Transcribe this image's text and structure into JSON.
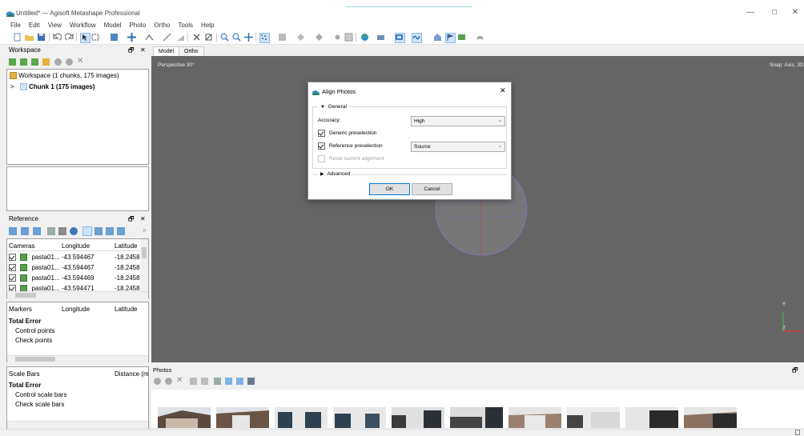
{
  "app": {
    "title": "Untitled* — Agisoft Metashape Professional",
    "window_controls": [
      "—",
      "☐",
      "✕"
    ]
  },
  "menu": [
    "File",
    "Edit",
    "View",
    "Workflow",
    "Model",
    "Photo",
    "Ortho",
    "Tools",
    "Help"
  ],
  "workspace": {
    "header": "Workspace",
    "root_label": "Workspace (1 chunks, 175 images)",
    "chunk_label": "Chunk 1 (175 images)"
  },
  "reference": {
    "header": "Reference",
    "cameras_cols": [
      "Cameras",
      "Longitude",
      "Latitude"
    ],
    "cameras": [
      {
        "name": "pasta01...",
        "lon": "-43.594467",
        "lat": "-18.2458"
      },
      {
        "name": "pasta01...",
        "lon": "-43.594467",
        "lat": "-18.2458"
      },
      {
        "name": "pasta01...",
        "lon": "-43.594469",
        "lat": "-18.2458"
      },
      {
        "name": "pasta01...",
        "lon": "-43.594471",
        "lat": "-18.2458"
      }
    ],
    "markers_cols": [
      "Markers",
      "Longitude",
      "Latitude"
    ],
    "markers_rows": [
      "Total Error",
      "Control points",
      "Check points"
    ],
    "scalebars_cols": [
      "Scale Bars",
      "Distance (m"
    ],
    "scalebars_rows": [
      "Total Error",
      "Control scale bars",
      "Check scale bars"
    ]
  },
  "viewport": {
    "tabs": [
      "Model",
      "Ortho"
    ],
    "perspective": "Perspective 30°",
    "snap": "Snap: Axis, 3D",
    "axis_y": "Y",
    "axis_z": "Z"
  },
  "photos": {
    "header": "Photos",
    "thumb_count": 10
  },
  "dialog": {
    "title": "Align Photos",
    "close": "✕",
    "general_label": "General",
    "accuracy_label": "Accuracy:",
    "accuracy_value": "High",
    "generic_preselection": "Generic preselection",
    "reference_preselection": "Reference preselection",
    "reference_value": "Source",
    "reset_alignment": "Reset current alignment",
    "advanced_label": "Advanced",
    "ok": "OK",
    "cancel": "Cancel"
  },
  "colors": {
    "viewport_bg": "#656565",
    "accent": "#0078d7",
    "sphere_lines": "#7a7ab8"
  }
}
